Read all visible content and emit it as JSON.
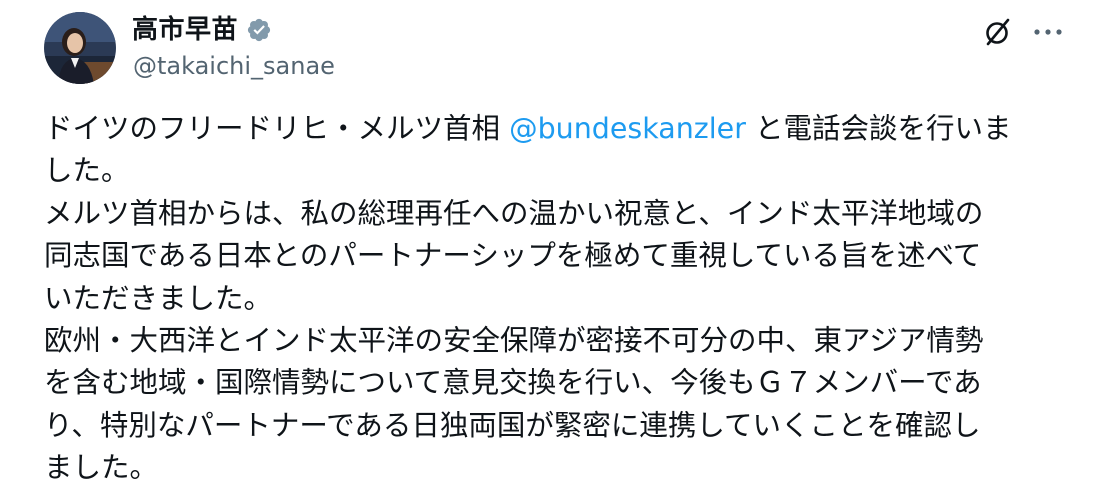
{
  "author": {
    "display_name": "高市早苗",
    "handle": "@takaichi_sanae",
    "verified_icon": "verified-badge-gray",
    "avatar_icon": "profile-photo"
  },
  "actions": {
    "grok_icon": "grok-icon",
    "more_icon": "more-horizontal-icon"
  },
  "colors": {
    "text": "#0f1419",
    "secondary_text": "#536471",
    "link": "#1d9bf0",
    "verified_badge": "#829aab"
  },
  "tweet": {
    "line1_before": "ドイツのフリードリヒ・メルツ首相 ",
    "mention": "@bundeskanzler",
    "line1_after": " と電話会談を行いま",
    "line2": "した。",
    "line3": "メルツ首相からは、私の総理再任への温かい祝意と、インド太平洋地域の",
    "line4": "同志国である日本とのパートナーシップを極めて重視している旨を述べて",
    "line5": "いただきました。",
    "line6": "欧州・大西洋とインド太平洋の安全保障が密接不可分の中、東アジア情勢",
    "line7": "を含む地域・国際情勢について意見交換を行い、今後もＧ７メンバーであ",
    "line8": "り、特別なパートナーである日独両国が緊密に連携していくことを確認し",
    "line9": "ました。"
  }
}
